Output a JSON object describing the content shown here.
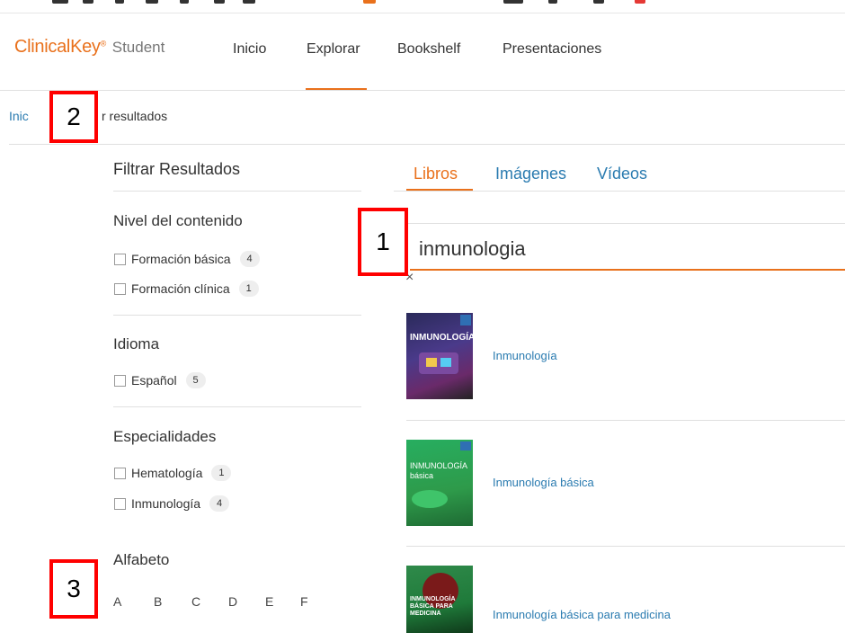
{
  "header": {
    "logo_brand": "ClinicalKey",
    "logo_reg": "®",
    "logo_suffix": "Student",
    "nav": [
      "Inicio",
      "Explorar",
      "Bookshelf",
      "Presentaciones"
    ],
    "active_nav": "Explorar"
  },
  "breadcrumb": {
    "home": "Inic",
    "current": "r resultados"
  },
  "filters": {
    "title": "Filtrar Resultados",
    "groups": [
      {
        "title": "Nivel del contenido",
        "options": [
          {
            "label": "Formación básica",
            "count": "4"
          },
          {
            "label": "Formación clínica",
            "count": "1"
          }
        ]
      },
      {
        "title": "Idioma",
        "options": [
          {
            "label": "Español",
            "count": "5"
          }
        ]
      },
      {
        "title": "Especialidades",
        "options": [
          {
            "label": "Hematología",
            "count": "1"
          },
          {
            "label": "Inmunología",
            "count": "4"
          }
        ]
      }
    ],
    "alphabet_title": "Alfabeto",
    "alphabet": [
      "A",
      "B",
      "C",
      "D",
      "E",
      "F"
    ]
  },
  "tabs": [
    "Libros",
    "Imágenes",
    "Vídeos"
  ],
  "active_tab": "Libros",
  "search": {
    "value": "inmunologia",
    "clear_symbol": "×"
  },
  "results": [
    {
      "title": "Inmunología",
      "cover_text": "INMUNOLOGÍA",
      "cover_color": "#3b2a6e"
    },
    {
      "title": "Inmunología básica",
      "cover_text": "INMUNOLOGÍA básica",
      "cover_color": "#2e9a4a"
    },
    {
      "title": "Inmunología básica para medicina",
      "cover_text": "INMUNOLOGÍA BÁSICA PARA MEDICINA",
      "cover_color": "#1f7a3a"
    }
  ],
  "markers": [
    "1",
    "2",
    "3"
  ],
  "colors": {
    "accent": "#e9711c",
    "link": "#2a7bb0",
    "marker": "#ff0000"
  }
}
